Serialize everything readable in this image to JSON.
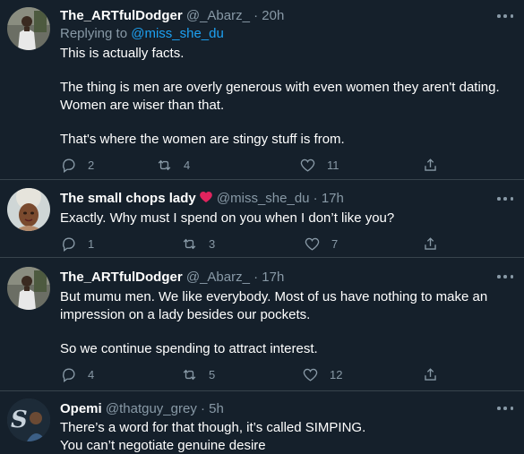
{
  "tweets": [
    {
      "name": "The_ARTfulDodger",
      "handle": "@_Abarz_",
      "dot": "·",
      "time": "20h",
      "replying_prefix": "Replying to",
      "replying_mention": "@miss_she_du",
      "paragraphs": [
        "This is actually facts.",
        "The thing is men are overly generous with even women they aren't dating. Women are wiser than that.",
        "That's where the women are stingy stuff is from."
      ],
      "reply_count": "2",
      "retweet_count": "4",
      "like_count": "11"
    },
    {
      "name": "The small chops lady",
      "handle": "@miss_she_du",
      "dot": "·",
      "time": "17h",
      "paragraphs": [
        "Exactly. Why must I spend on you when I don’t like you?"
      ],
      "reply_count": "1",
      "retweet_count": "3",
      "like_count": "7"
    },
    {
      "name": "The_ARTfulDodger",
      "handle": "@_Abarz_",
      "dot": "·",
      "time": "17h",
      "paragraphs": [
        "But mumu men. We like everybody. Most of us have nothing to make an impression on a lady besides our pockets.",
        "So we continue spending to attract interest."
      ],
      "reply_count": "4",
      "retweet_count": "5",
      "like_count": "12"
    },
    {
      "name": "Opemi",
      "handle": "@thatguy_grey",
      "dot": "·",
      "time": "5h",
      "lines": [
        "There’s a word for that though, it’s called SIMPING.",
        "You can’t negotiate genuine desire"
      ]
    }
  ],
  "colors": {
    "background": "#15202b",
    "text": "#ffffff",
    "secondary": "#8899a6",
    "link": "#1da1f2",
    "divider": "#38444d",
    "heart": "#e0245e"
  },
  "icons": [
    "reply-icon",
    "retweet-icon",
    "like-icon",
    "share-icon",
    "more-icon",
    "heart-emoji-icon"
  ]
}
